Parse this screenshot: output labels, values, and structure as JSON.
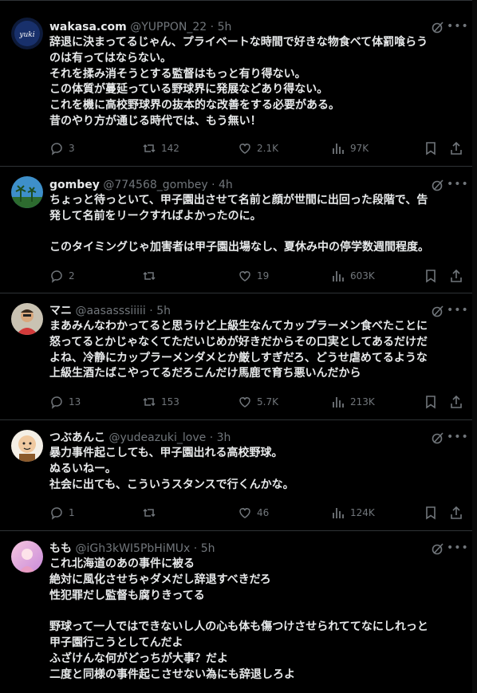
{
  "tweets": [
    {
      "name": "wakasa.com",
      "handle": "@YUPPON_22",
      "dot": "·",
      "time": "5h",
      "avatar_icon": "wakasa-logo-avatar",
      "text": "辞退に決まってるじゃん、プライベートな時間で好きな物食べて体罰喰らう\nのは有ってはならない。\nそれを揉み消そうとする監督はもっと有り得ない。\nこの体質が蔓延っている野球界に発展などあり得ない。\nこれを機に高校野球界の抜本的な改善をする必要がある。\n昔のやり方が通じる時代では、もう無い！",
      "replies": "3",
      "reposts": "142",
      "likes": "2.1K",
      "views": "97K"
    },
    {
      "name": "gombey",
      "handle": "@774568_gombey",
      "dot": "·",
      "time": "4h",
      "avatar_icon": "palm-tree-avatar",
      "text": "ちょっと待っといて、甲子園出させて名前と顔が世間に出回った段階で、告\n発して名前をリークすればよかったのに。\n\nこのタイミングじゃ加害者は甲子園出場なし、夏休み中の停学数週間程度。",
      "replies": "2",
      "reposts": "",
      "likes": "19",
      "views": "603K"
    },
    {
      "name": "マニ",
      "handle": "@aasasssiiiii",
      "dot": "·",
      "time": "5h",
      "avatar_icon": "person-photo-avatar",
      "text": "まあみんなわかってると思うけど上級生なんてカップラーメン食べたことに\n怒ってるとかじゃなくてただいじめが好きだからその口実としてあるだけだ\nよね、冷静にカップラーメンダメとか厳しすぎだろ、どうせ虐めてるような\n上級生酒たばこやってるだろこんだけ馬鹿で育ち悪いんだから",
      "replies": "13",
      "reposts": "153",
      "likes": "5.7K",
      "views": "213K"
    },
    {
      "name": "つぶあんこ",
      "handle": "@yudeazuki_love",
      "dot": "·",
      "time": "3h",
      "avatar_icon": "cartoon-character-avatar",
      "text": "暴力事件起こしても、甲子園出れる高校野球。\nぬるいねー。\n社会に出ても、こういうスタンスで行くんかな。",
      "replies": "1",
      "reposts": "",
      "likes": "46",
      "views": "124K"
    },
    {
      "name": "もも",
      "handle": "@iGh3kWI5PbHiMUx",
      "dot": "·",
      "time": "5h",
      "avatar_icon": "pink-illustration-avatar",
      "text": "これ北海道のあの事件に被る\n絶対に風化させちゃダメだし辞退すべきだろ\n性犯罪だし監督も腐りきってる\n\n野球って一人ではできないし人の心も体も傷つけさせられててなにしれっと\n甲子園行こうとしてんだよ\nふざけんな何がどっちが大事？だよ\n二度と同様の事件起こさせない為にも辞退しろよ",
      "replies": "",
      "reposts": "",
      "likes": "",
      "views": ""
    }
  ],
  "more_glyph": "•••",
  "colors": {
    "background": "#000000",
    "text": "#e7e9ea",
    "secondary": "#71767b",
    "border": "#2f3336"
  }
}
